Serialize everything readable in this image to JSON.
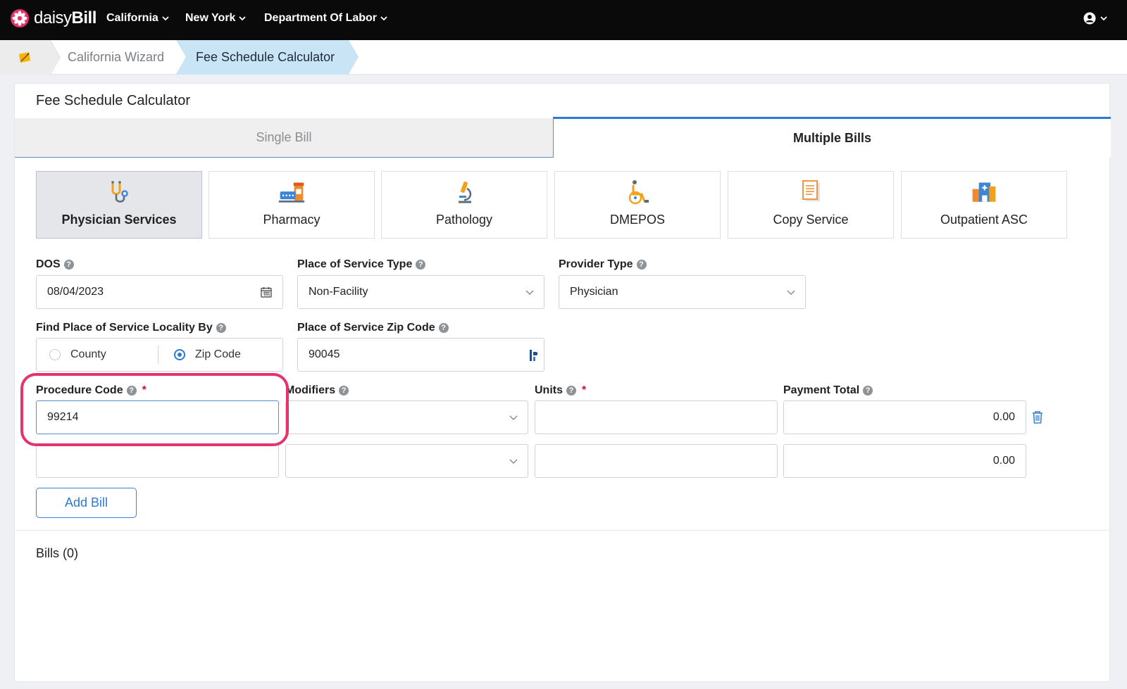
{
  "brand": {
    "name_light": "daisy",
    "name_bold": "Bill"
  },
  "nav": {
    "items": [
      {
        "label": "California"
      },
      {
        "label": "New York"
      },
      {
        "label": "Department Of Labor"
      }
    ]
  },
  "breadcrumb": {
    "items": [
      {
        "label": "California Wizard"
      },
      {
        "label": "Fee Schedule Calculator"
      }
    ]
  },
  "page": {
    "title": "Fee Schedule Calculator"
  },
  "tabs": [
    {
      "label": "Single Bill",
      "active": false
    },
    {
      "label": "Multiple Bills",
      "active": true
    }
  ],
  "services": [
    {
      "label": "Physician Services",
      "icon": "stethoscope-icon",
      "active": true
    },
    {
      "label": "Pharmacy",
      "icon": "pharmacy-icon",
      "active": false
    },
    {
      "label": "Pathology",
      "icon": "microscope-icon",
      "active": false
    },
    {
      "label": "DMEPOS",
      "icon": "wheelchair-icon",
      "active": false
    },
    {
      "label": "Copy Service",
      "icon": "document-icon",
      "active": false
    },
    {
      "label": "Outpatient ASC",
      "icon": "hospital-icon",
      "active": false
    }
  ],
  "form": {
    "dos": {
      "label": "DOS",
      "value": "08/04/2023"
    },
    "place_type": {
      "label": "Place of Service Type",
      "value": "Non-Facility"
    },
    "provider_type": {
      "label": "Provider Type",
      "value": "Physician"
    },
    "locality": {
      "label": "Find Place of Service Locality By",
      "options": [
        "County",
        "Zip Code"
      ],
      "selected": "Zip Code"
    },
    "zip": {
      "label": "Place of Service Zip Code",
      "value": "90045"
    },
    "procedure": {
      "label": "Procedure Code",
      "required_mark": "*"
    },
    "modifiers": {
      "label": "Modifiers"
    },
    "units": {
      "label": "Units",
      "required_mark": "*"
    },
    "payment": {
      "label": "Payment Total"
    },
    "rows": [
      {
        "procedure": "99214",
        "modifier": "",
        "units": "",
        "payment": "0.00"
      },
      {
        "procedure": "",
        "modifier": "",
        "units": "",
        "payment": "0.00"
      }
    ]
  },
  "add_bill_label": "Add Bill",
  "bills_label": "Bills (0)",
  "colors": {
    "accent": "#2d7ad4",
    "highlight": "#e8316f",
    "topbar": "#0a0a0a",
    "breadcrumb_active": "#c8e4f5"
  }
}
